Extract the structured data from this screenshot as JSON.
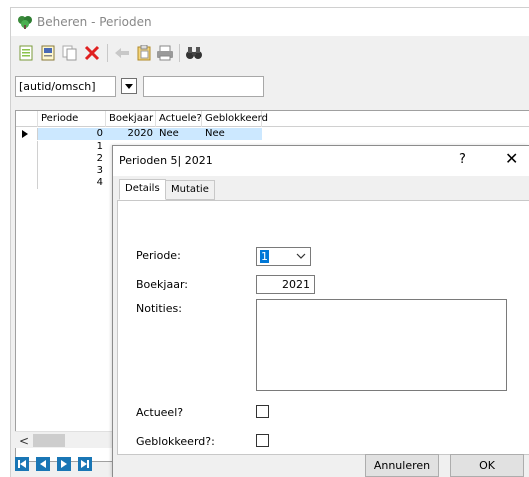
{
  "main_window": {
    "title": "Beheren - Perioden",
    "icon": "tree-icon"
  },
  "toolbar": {
    "buttons": [
      "new-document-icon",
      "properties-icon",
      "copy-icon",
      "delete-icon",
      "back-icon",
      "clipboard-icon",
      "print-icon",
      "find-icon"
    ]
  },
  "filter": {
    "field_label": "[autid/omsch]",
    "value": ""
  },
  "grid": {
    "columns": [
      "Periode",
      "Boekjaar",
      "Actuele?",
      "Geblokkeerd"
    ],
    "rows": [
      {
        "periode": "0",
        "boekjaar": "2020",
        "actuele": "Nee",
        "geblokkeerd": "Nee",
        "selected": true
      },
      {
        "periode": "1",
        "boekjaar": "",
        "actuele": "",
        "geblokkeerd": "",
        "selected": false
      },
      {
        "periode": "2",
        "boekjaar": "",
        "actuele": "",
        "geblokkeerd": "",
        "selected": false
      },
      {
        "periode": "3",
        "boekjaar": "",
        "actuele": "",
        "geblokkeerd": "",
        "selected": false
      },
      {
        "periode": "4",
        "boekjaar": "",
        "actuele": "",
        "geblokkeerd": "",
        "selected": false
      }
    ]
  },
  "scrollbar": {
    "left_arrow": "<"
  },
  "dialog": {
    "title": "Perioden 5| 2021",
    "help": "?",
    "close": "✕",
    "tabs": [
      "Details",
      "Mutatie"
    ],
    "active_tab": "Details",
    "fields": {
      "periode_label": "Periode:",
      "periode_value": "1",
      "boekjaar_label": "Boekjaar:",
      "boekjaar_value": "2021",
      "notities_label": "Notities:",
      "notities_value": "",
      "actueel_label": "Actueel?",
      "actueel_checked": false,
      "geblokkeerd_label": "Geblokkeerd?:",
      "geblokkeerd_checked": false
    },
    "buttons": {
      "cancel": "Annuleren",
      "ok": "OK"
    }
  },
  "colors": {
    "selection": "#cce8ff",
    "nav_blue": "#1976b5",
    "delete_red": "#e02020"
  }
}
